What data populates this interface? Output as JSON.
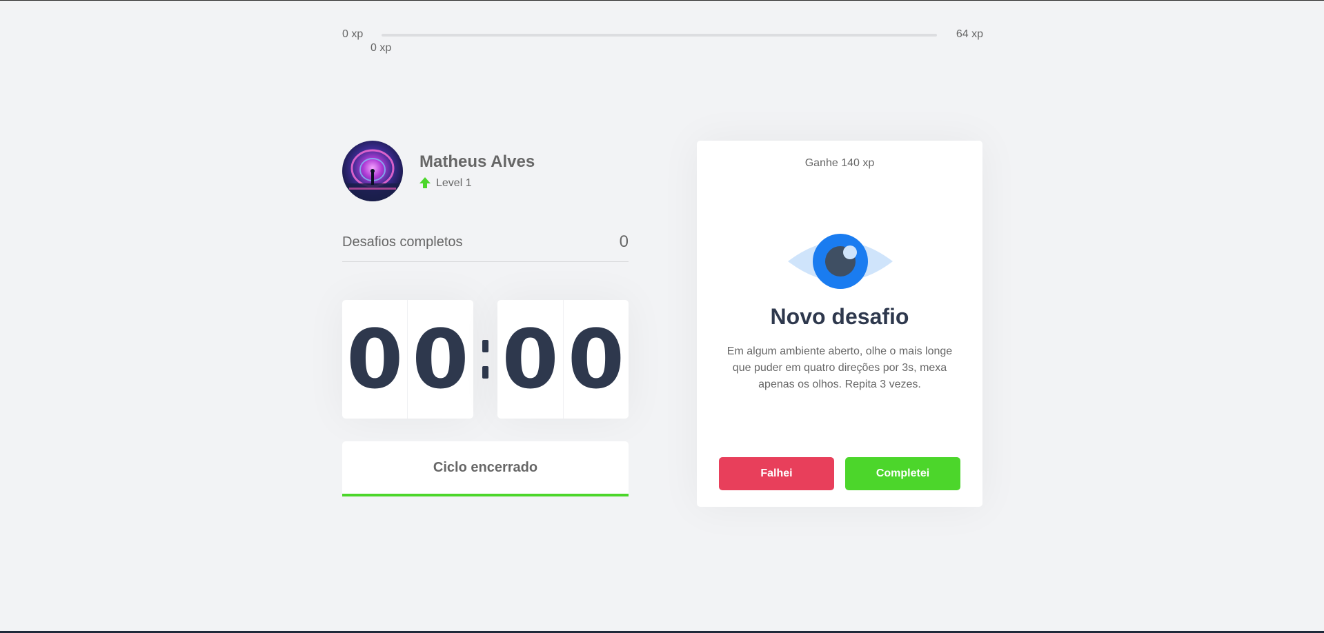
{
  "colors": {
    "background": "#f2f3f5",
    "text": "#666666",
    "title": "#2e384d",
    "green": "#4cd62b",
    "red": "#e83f5b",
    "blue": "#5965e0"
  },
  "experience": {
    "min_label": "0 xp",
    "max_label": "64 xp",
    "current_label": "0 xp",
    "progress_fraction": 0
  },
  "profile": {
    "name": "Matheus Alves",
    "level_label": "Level 1",
    "level_icon": "level-up-arrow-icon",
    "avatar": "avatar-image"
  },
  "completed_challenges": {
    "label": "Desafios completos",
    "count": "0"
  },
  "countdown": {
    "minute_left": "0",
    "minute_right": "0",
    "second_left": "0",
    "second_right": "0"
  },
  "cycle_button": {
    "label": "Ciclo encerrado"
  },
  "challenge": {
    "reward": "Ganhe 140 xp",
    "icon": "eye-icon",
    "title": "Novo desafio",
    "description": "Em algum ambiente aberto, olhe o mais longe que puder em quatro direções por 3s, mexa apenas os olhos. Repita 3 vezes.",
    "failed_label": "Falhei",
    "completed_label": "Completei"
  }
}
